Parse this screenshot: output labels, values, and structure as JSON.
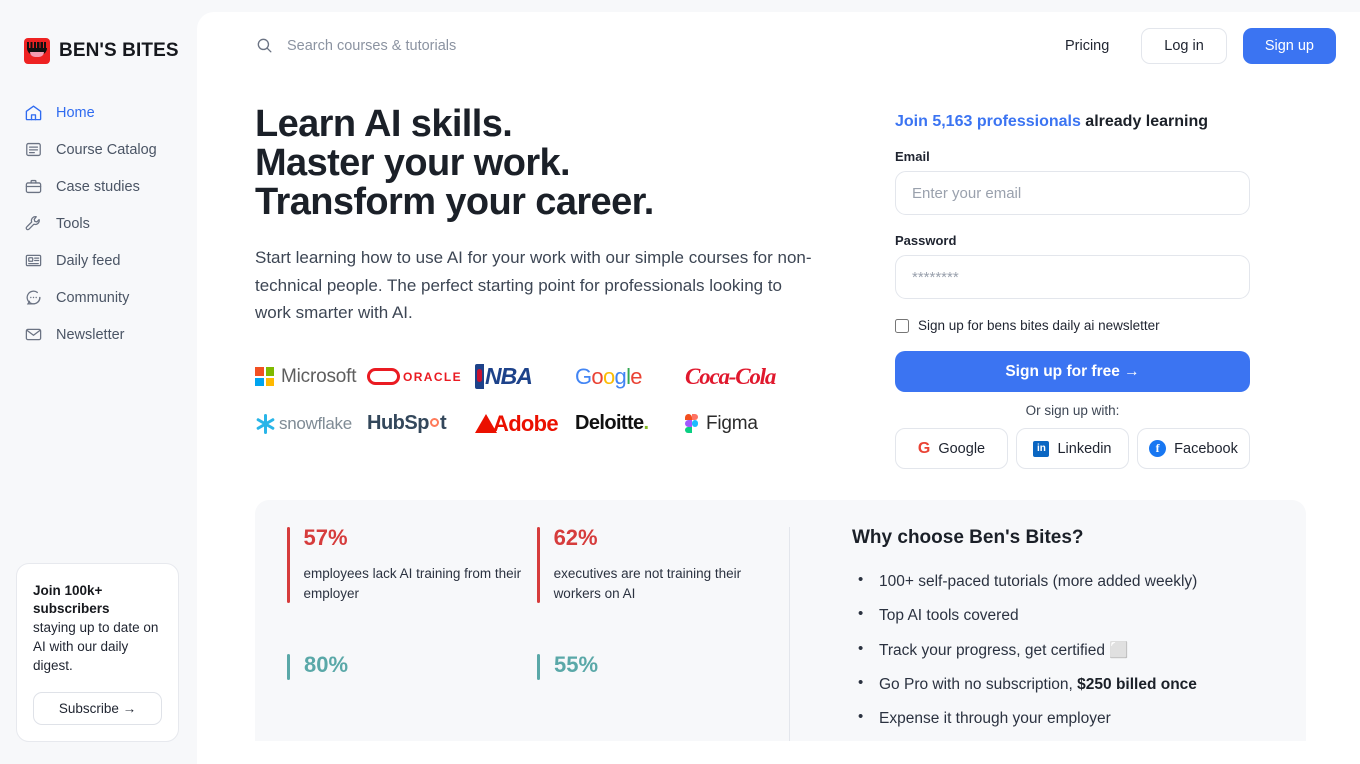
{
  "brand": {
    "name": "BEN'S BITES",
    "logo_icon": "bens-bites-mouth-logo",
    "accent": "#3b74f2",
    "logo_bg": "#ee2222"
  },
  "sidebar": {
    "items": [
      {
        "label": "Home",
        "icon": "home-icon",
        "active": true
      },
      {
        "label": "Course Catalog",
        "icon": "article-list-icon",
        "active": false
      },
      {
        "label": "Case studies",
        "icon": "briefcase-icon",
        "active": false
      },
      {
        "label": "Tools",
        "icon": "wrench-icon",
        "active": false
      },
      {
        "label": "Daily feed",
        "icon": "newspaper-icon",
        "active": false
      },
      {
        "label": "Community",
        "icon": "chat-bubble-icon",
        "active": false
      },
      {
        "label": "Newsletter",
        "icon": "envelope-icon",
        "active": false
      }
    ],
    "subscribe_card": {
      "title": "Join 100k+ subscribers",
      "desc": "staying up to date on AI with our daily digest.",
      "button": "Subscribe →"
    }
  },
  "topbar": {
    "search_placeholder": "Search courses & tutorials",
    "search_value": "",
    "search_icon": "search-icon",
    "pricing": "Pricing",
    "login": "Log in",
    "signup": "Sign up"
  },
  "hero": {
    "headline_line1": "Learn AI skills.",
    "headline_line2": "Master your work.",
    "headline_line3": "Transform your career.",
    "subtext": "Start learning how to use AI for your work with our simple courses for non-technical people. The perfect starting point for professionals looking to work smarter with AI.",
    "logos_row1": [
      "Microsoft",
      "ORACLE",
      "NBA",
      "Google",
      "Coca-Cola"
    ],
    "logos_row2": [
      "snowflake",
      "HubSpot",
      "Adobe",
      "Deloitte.",
      "Figma"
    ]
  },
  "form": {
    "join_highlight": "Join 5,163 professionals",
    "join_rest": " already learning",
    "email_label": "Email",
    "email_placeholder": "Enter your email",
    "email_value": "",
    "password_label": "Password",
    "password_placeholder": "********",
    "password_value": "",
    "newsletter_checkbox": "Sign up for bens bites daily ai newsletter",
    "newsletter_checked": false,
    "cta": "Sign up for free →",
    "or_text": "Or sign up with:",
    "socials": [
      {
        "label": "Google",
        "icon": "google-icon"
      },
      {
        "label": "Linkedin",
        "icon": "linkedin-icon"
      },
      {
        "label": "Facebook",
        "icon": "facebook-icon"
      }
    ]
  },
  "stats": {
    "items": [
      {
        "value": "57%",
        "text": "employees lack AI training from their employer",
        "tone": "red"
      },
      {
        "value": "62%",
        "text": "executives are not training their workers on AI",
        "tone": "red"
      },
      {
        "value": "80%",
        "text": "",
        "tone": "teal"
      },
      {
        "value": "55%",
        "text": "",
        "tone": "teal"
      }
    ],
    "red_color": "#d63c3c",
    "teal_color": "#5aa8a8"
  },
  "why": {
    "title": "Why choose Ben's Bites?",
    "bullets": [
      {
        "text": "100+ self-paced tutorials (more added weekly)",
        "bold": ""
      },
      {
        "text": "Top AI tools covered",
        "bold": ""
      },
      {
        "text": "Track your progress, get certified ⬜",
        "bold": ""
      },
      {
        "text": "Go Pro with no subscription, ",
        "bold": "$250 billed once"
      },
      {
        "text": "Expense it through your employer",
        "bold": ""
      }
    ]
  }
}
